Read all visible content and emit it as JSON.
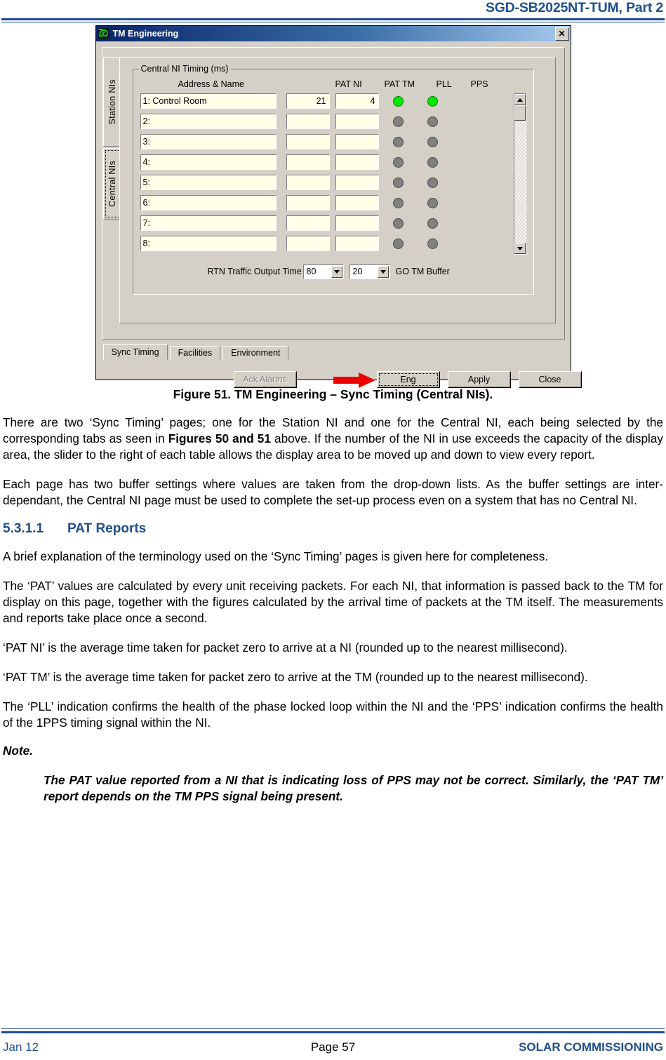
{
  "page": {
    "header_title": "SGD-SB2025NT-TUM, Part 2",
    "footer_left": "Jan 12",
    "footer_center": "Page 57",
    "footer_right": "SOLAR COMMISSIONING"
  },
  "dialog": {
    "title": "TM Engineering",
    "close_label": "✕",
    "vertical_tabs": [
      {
        "label": "Station NIs",
        "selected": false
      },
      {
        "label": "Central NIs",
        "selected": true
      }
    ],
    "groupbox": {
      "label": "Central NI Timing (ms)",
      "columns": {
        "name": "Address & Name",
        "pat_ni": "PAT NI",
        "pat_tm": "PAT TM",
        "pll": "PLL",
        "pps": "PPS"
      },
      "rows": [
        {
          "name": "1:  Control Room",
          "pat_ni": "21",
          "pat_tm": "4",
          "pll": "on",
          "pps": "on"
        },
        {
          "name": "2:",
          "pat_ni": "",
          "pat_tm": "",
          "pll": "off",
          "pps": "off"
        },
        {
          "name": "3:",
          "pat_ni": "",
          "pat_tm": "",
          "pll": "off",
          "pps": "off"
        },
        {
          "name": "4:",
          "pat_ni": "",
          "pat_tm": "",
          "pll": "off",
          "pps": "off"
        },
        {
          "name": "5:",
          "pat_ni": "",
          "pat_tm": "",
          "pll": "off",
          "pps": "off"
        },
        {
          "name": "6:",
          "pat_ni": "",
          "pat_tm": "",
          "pll": "off",
          "pps": "off"
        },
        {
          "name": "7:",
          "pat_ni": "",
          "pat_tm": "",
          "pll": "off",
          "pps": "off"
        },
        {
          "name": "8:",
          "pat_ni": "",
          "pat_tm": "",
          "pll": "off",
          "pps": "off"
        }
      ],
      "rtn_label": "RTN Traffic Output Time",
      "rtn_value": "80",
      "buffer_value": "20",
      "buffer_label": "GO TM Buffer"
    },
    "horizontal_tabs": [
      {
        "label": "Sync Timing",
        "selected": true
      },
      {
        "label": "Facilities",
        "selected": false
      },
      {
        "label": "Environment",
        "selected": false
      }
    ],
    "buttons": {
      "ack_alarms": "Ack Alarms",
      "eng": "Eng",
      "apply": "Apply",
      "close": "Close"
    },
    "colors": {
      "led_on": "#00E800",
      "led_off": "#808080",
      "face": "#D4D0C8",
      "field": "#FFFFE8",
      "titlebar_start": "#0A246A",
      "annotation_arrow": "#EE0000"
    }
  },
  "figure": {
    "caption": "Figure 51.  TM Engineering – Sync Timing (Central NIs)."
  },
  "text": {
    "para1_a": "There are two ‘Sync Timing’ pages; one for the Station NI and one for the Central NI, each being selected by the corresponding tabs as seen in ",
    "para1_bold": "Figures 50 and 51",
    "para1_b": " above.  If the number of the NI in use exceeds the capacity of the display area, the slider to the right of each table allows the display area to be moved up and down to view every report.",
    "para2": "Each page has two buffer settings where values are taken from the drop-down lists.  As the buffer settings are inter-dependant, the Central NI page must be used to complete the set-up process even on a system that has no Central NI.",
    "section_number": "5.3.1.1",
    "section_title": "PAT Reports",
    "para3": "A brief explanation of the terminology used on the ‘Sync Timing’ pages is given here for completeness.",
    "para4": "The ‘PAT’ values are calculated by every unit receiving packets.  For each NI, that information is passed back to the TM for display on this page, together with the figures calculated by the arrival time of packets at the TM itself.  The measurements and reports take place once a second.",
    "para5": "‘PAT NI’ is the average time taken for packet zero to arrive at a NI (rounded up to the nearest millisecond).",
    "para6": "‘PAT TM’ is the average time taken for packet zero to arrive at the TM (rounded up to the nearest millisecond).",
    "para7": "The ‘PLL’ indication confirms the health of the phase locked loop within the NI and the ‘PPS’ indication confirms the health of the 1PPS timing signal within the NI.",
    "note_label": "Note.",
    "note_body": "The PAT value reported from a NI that is indicating loss of PPS may not be correct.  Similarly, the ‘PAT TM’ report depends on the TM PPS signal being present."
  }
}
